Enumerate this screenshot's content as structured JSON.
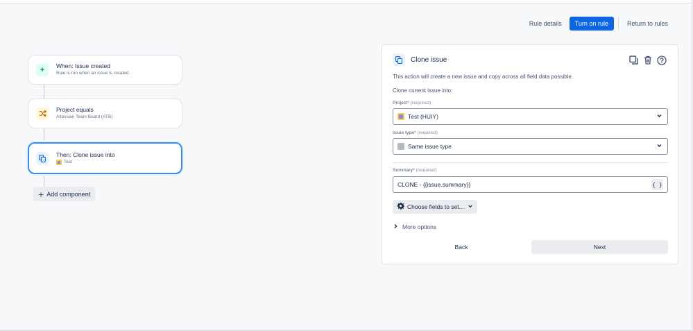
{
  "header": {
    "rule_details": "Rule details",
    "turn_on_rule": "Turn on rule",
    "return_to_rules": "Return to rules"
  },
  "flow": {
    "nodes": [
      {
        "title": "When: Issue created",
        "subtitle": "Rule is run when an issue is created.",
        "icon": "plus-icon",
        "color": "#1f845a"
      },
      {
        "title": "Project equals",
        "subtitle": "Atlassian Team Board (ATB)",
        "icon": "shuffle-icon",
        "color": "#c25100"
      },
      {
        "title": "Then: Clone issue into",
        "subtitle": "Test",
        "icon": "clone-icon",
        "color": "#0c66e4",
        "selected": true
      }
    ],
    "add_component": "Add component"
  },
  "panel": {
    "title": "Clone issue",
    "description": "This action will create a new issue and copy across all field data possible.",
    "clone_into_label": "Clone current issue into:",
    "project": {
      "label": "Project",
      "required": "(required)",
      "value": "Test (HUIY)"
    },
    "issue_type": {
      "label": "Issue type",
      "required": "(required)",
      "value": "Same issue type"
    },
    "summary": {
      "label": "Summary",
      "required": "(required)",
      "value": "CLONE - {{issue.summary}}",
      "smart_value_button": "{ }"
    },
    "choose_fields": "Choose fields to set...",
    "more_options": "More options",
    "back": "Back",
    "next": "Next"
  },
  "colors": {
    "primary": "#0c66e4",
    "selected_border": "#388bff",
    "required": "#c9372c"
  }
}
